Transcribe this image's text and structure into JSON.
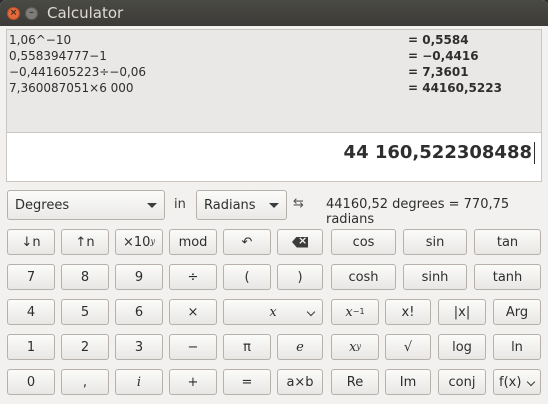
{
  "window": {
    "title": "Calculator"
  },
  "history": [
    {
      "expr": "1,06^−10",
      "result": "= 0,5584"
    },
    {
      "expr": "0,558394777−1",
      "result": "= −0,4416"
    },
    {
      "expr": "−0,441605223÷−0,06",
      "result": "= 7,3601"
    },
    {
      "expr": "7,360087051×6 000",
      "result": "= 44160,5223"
    }
  ],
  "display": {
    "value": "44 160,522308488"
  },
  "conversion": {
    "from_unit": "Degrees",
    "in_label": "in",
    "to_unit": "Radians",
    "result": "44160,52 degrees = 770,75 radians"
  },
  "buttons": {
    "shift_down": "↓n",
    "shift_up": "↑n",
    "ten_pow": "×10",
    "ten_pow_sup": "y",
    "mod": "mod",
    "undo": "↶",
    "cos": "cos",
    "sin": "sin",
    "tan": "tan",
    "seven": "7",
    "eight": "8",
    "nine": "9",
    "divide": "÷",
    "lparen": "(",
    "rparen": ")",
    "cosh": "cosh",
    "sinh": "sinh",
    "tanh": "tanh",
    "four": "4",
    "five": "5",
    "six": "6",
    "multiply": "×",
    "variable": "x",
    "inverse_base": "x",
    "inverse_sup": "−1",
    "factorial": "x!",
    "abs": "|x|",
    "arg": "Arg",
    "one": "1",
    "two": "2",
    "three": "3",
    "subtract": "−",
    "pi": "π",
    "e": "e",
    "power_base": "x",
    "power_sup": "y",
    "sqrt": "√",
    "log": "log",
    "ln": "ln",
    "zero": "0",
    "decimal": ",",
    "imaginary": "i",
    "add": "+",
    "equals": "=",
    "times_b": "a×b",
    "re": "Re",
    "im": "Im",
    "conj": "conj",
    "function": "f(x)"
  }
}
